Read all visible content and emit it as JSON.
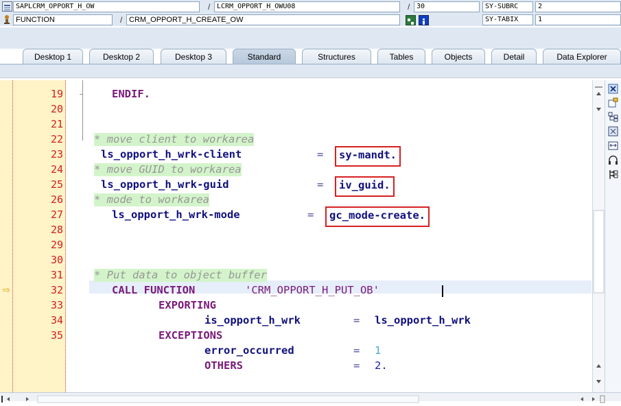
{
  "header": {
    "program": "SAPLCRM_OPPORT_H_OW",
    "include": "LCRM_OPPORT_H_OWU08",
    "line": "30",
    "sysvar1_name": "SY-SUBRC",
    "sysvar1_value": "2",
    "event_type": "FUNCTION",
    "event_name": "CRM_OPPORT_H_CREATE_OW",
    "sysvar2_name": "SY-TABIX",
    "sysvar2_value": "1",
    "slash": "/"
  },
  "tabs": [
    "Desktop 1",
    "Desktop 2",
    "Desktop 3",
    "Standard",
    "Structures",
    "Tables",
    "Objects",
    "Detail",
    "Data Explorer"
  ],
  "active_tab": "Standard",
  "line_numbers": [
    "19",
    "20",
    "21",
    "22",
    "23",
    "24",
    "25",
    "26",
    "27",
    "28",
    "29",
    "30",
    "31",
    "32",
    "33",
    "34",
    "35"
  ],
  "code": {
    "l19": "ENDIF.",
    "l22": "* move client to workarea",
    "l23_lhs": "ls_opport_h_wrk-client",
    "l23_eq": "=",
    "l23_rhs": "sy-mandt.",
    "l24": "* move GUID to workarea",
    "l25_lhs": "ls_opport_h_wrk-guid",
    "l25_eq": "=",
    "l25_rhs": "iv_guid.",
    "l26": "* mode to workarea",
    "l27_lhs": "ls_opport_h_wrk-mode",
    "l27_eq": "=",
    "l27_rhs": "gc_mode-create.",
    "l29": "* Put data to object buffer",
    "l30_kw": "CALL FUNCTION",
    "l30_str": "'CRM_OPPORT_H_PUT_OB'",
    "l31": "EXPORTING",
    "l32_lhs": "is_opport_h_wrk",
    "l32_eq": "=",
    "l32_rhs": "ls_opport_h_wrk",
    "l33": "EXCEPTIONS",
    "l34_lhs": "error_occurred",
    "l34_eq": "=",
    "l34_rhs": "1",
    "l35_lhs": "OTHERS",
    "l35_eq": "=",
    "l35_rhs": "2."
  },
  "current_line_marker": "⇨",
  "colors": {
    "keyword": "#7a1a7a",
    "comment_bg": "#d3f4ca",
    "highlight_border": "#d62020",
    "line_number": "#d02020"
  },
  "icons": [
    "program-icon",
    "function-icon",
    "navigate-icon",
    "info-icon",
    "close-icon",
    "edit-icon",
    "structure-icon",
    "fullscreen-icon",
    "resize-icon",
    "headset-icon",
    "tree-icon"
  ]
}
